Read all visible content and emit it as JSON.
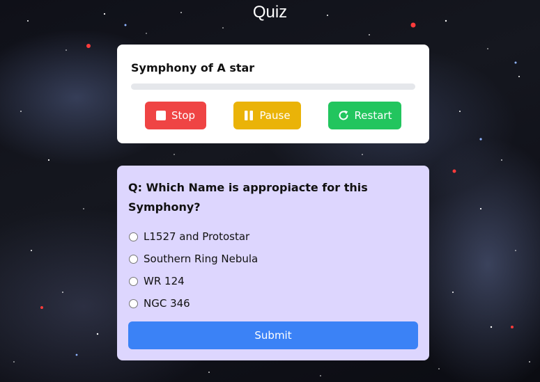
{
  "page": {
    "title": "Quiz"
  },
  "player": {
    "track_title": "Symphony of A star",
    "progress": 0,
    "buttons": {
      "stop": {
        "label": "Stop",
        "color": "#ef4444",
        "icon": "stop-icon"
      },
      "pause": {
        "label": "Pause",
        "color": "#eab308",
        "icon": "pause-icon"
      },
      "restart": {
        "label": "Restart",
        "color": "#22c55e",
        "icon": "restart-icon"
      }
    }
  },
  "quiz": {
    "question": "Q: Which Name is appropiacte for this Symphony?",
    "options": [
      {
        "label": "L1527 and Protostar",
        "selected": false
      },
      {
        "label": "Southern Ring Nebula",
        "selected": false
      },
      {
        "label": "WR 124",
        "selected": false
      },
      {
        "label": "NGC 346",
        "selected": false
      }
    ],
    "submit_label": "Submit",
    "colors": {
      "card": "#ddd6fe",
      "submit": "#3b82f6"
    }
  }
}
